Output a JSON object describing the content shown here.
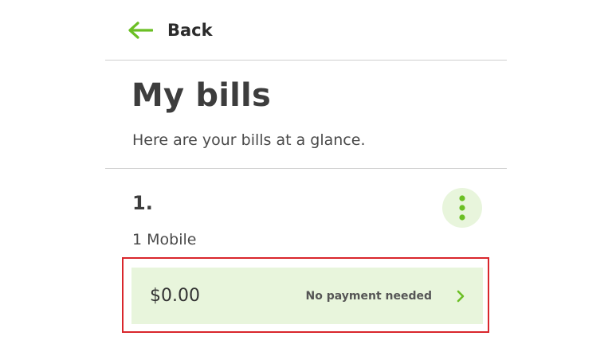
{
  "header": {
    "back_label": "Back",
    "back_icon": "arrow-left-icon"
  },
  "title": "My bills",
  "subtitle": "Here are your bills at a glance.",
  "bill": {
    "number": "1.",
    "description": "1 Mobile",
    "menu_icon": "more-vertical-icon",
    "amount": "$0.00",
    "status": "No payment needed",
    "chevron_icon": "chevron-right-icon"
  },
  "colors": {
    "accent": "#6bbf24",
    "card_background": "#e8f5dc",
    "highlight_border": "#d9262c",
    "text_dark": "#3d3d3d"
  }
}
